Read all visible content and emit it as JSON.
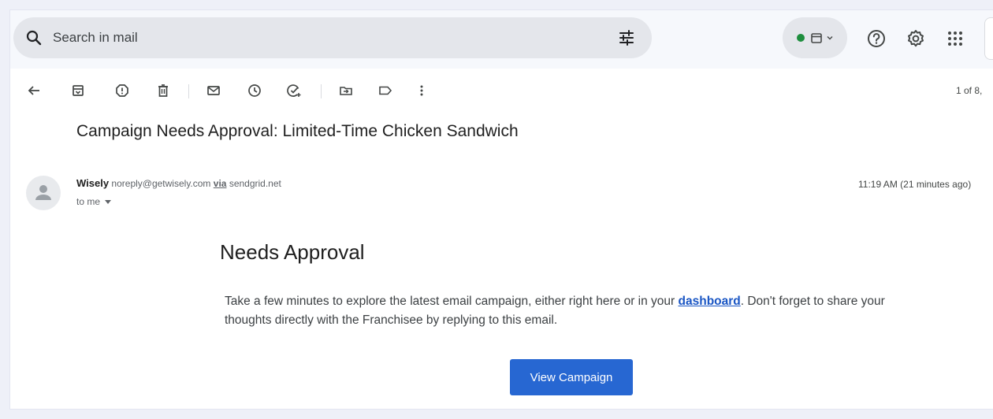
{
  "search": {
    "placeholder": "Search in mail",
    "icon": "search-icon",
    "filter_icon": "tune-icon"
  },
  "top_actions": {
    "status_color": "#1e8e3e",
    "icons": [
      "calendar-icon",
      "chevron-down-icon",
      "help-icon",
      "settings-icon",
      "apps-grid-icon"
    ]
  },
  "toolbar": {
    "icons": [
      "back-arrow-icon",
      "archive-icon",
      "report-spam-icon",
      "delete-icon",
      "mark-unread-icon",
      "snooze-icon",
      "add-task-icon",
      "move-to-icon",
      "label-icon",
      "more-vert-icon"
    ],
    "pager": "1 of 8,"
  },
  "email": {
    "subject": "Campaign Needs Approval: Limited-Time Chicken Sandwich",
    "sender_name": "Wisely",
    "sender_email": "noreply@getwisely.com",
    "via_label": "via",
    "via_domain": "sendgrid.net",
    "to": "to me",
    "timestamp": "11:19 AM (21 minutes ago)",
    "body": {
      "heading": "Needs Approval",
      "text_before_link": "Take a few minutes to explore the latest email campaign, either right here or in your ",
      "link_text": "dashboard",
      "text_after_link": ". Don't forget to share your thoughts directly with the Franchisee by replying to this email.",
      "button_label": "View Campaign"
    }
  },
  "colors": {
    "accent": "#2767d2",
    "link": "#1a56c4",
    "search_bg": "#e4e6eb"
  }
}
